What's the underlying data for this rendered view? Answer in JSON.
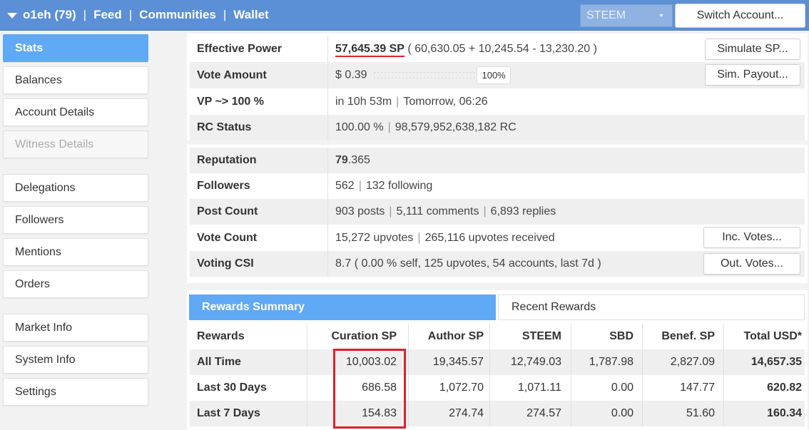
{
  "topbar": {
    "account": "o1eh (79)",
    "nav": [
      "Feed",
      "Communities",
      "Wallet"
    ],
    "select_value": "STEEM",
    "switch_label": "Switch Account..."
  },
  "sidebar": {
    "items": [
      "Stats",
      "Balances",
      "Account Details",
      "Witness Details",
      "Delegations",
      "Followers",
      "Mentions",
      "Orders",
      "Market Info",
      "System Info",
      "Settings"
    ]
  },
  "stats": {
    "effective_power_label": "Effective Power",
    "effective_power_value": "57,645.39 SP",
    "effective_power_detail": " ( 60,630.05 + 10,245.54 - 13,230.20 )",
    "simulate_sp": "Simulate SP...",
    "vote_amount_label": "Vote Amount",
    "vote_amount_value": "$ 0.39",
    "vote_pct": "100%",
    "vote_fill": 1.0,
    "sim_payout": "Sim. Payout...",
    "vp_label": "VP ~> 100 %",
    "vp_time": "in 10h 53m",
    "vp_when": "Tomorrow, 06:26",
    "rc_label": "RC Status",
    "rc_pct": "100.00 %",
    "rc_value": "98,579,952,638,182 RC",
    "rep_label": "Reputation",
    "rep_int": "79",
    "rep_dec": ".365",
    "followers_label": "Followers",
    "followers": "562",
    "following": "132 following",
    "post_count_label": "Post Count",
    "posts": "903 posts",
    "comments": "5,111 comments",
    "replies": "6,893 replies",
    "vote_count_label": "Vote Count",
    "upvotes": "15,272 upvotes",
    "upvotes_received": "265,116 upvotes received",
    "inc_votes": "Inc. Votes...",
    "csi_label": "Voting CSI",
    "csi_value": "8.7 ( 0.00 % self, 125 upvotes, 54 accounts, last 7d )",
    "out_votes": "Out. Votes..."
  },
  "rewards": {
    "tab_summary": "Rewards Summary",
    "tab_recent": "Recent Rewards",
    "headers": [
      "Rewards",
      "Curation SP",
      "Author SP",
      "STEEM",
      "SBD",
      "Benef. SP",
      "Total USD*"
    ],
    "rows": [
      [
        "All Time",
        "10,003.02",
        "19,345.57",
        "12,749.03",
        "1,787.98",
        "2,827.09",
        "14,657.35"
      ],
      [
        "Last 30 Days",
        "686.58",
        "1,072.70",
        "1,071.11",
        "0.00",
        "147.77",
        "620.82"
      ],
      [
        "Last 7 Days",
        "154.83",
        "274.74",
        "274.57",
        "0.00",
        "51.60",
        "160.34"
      ]
    ]
  }
}
